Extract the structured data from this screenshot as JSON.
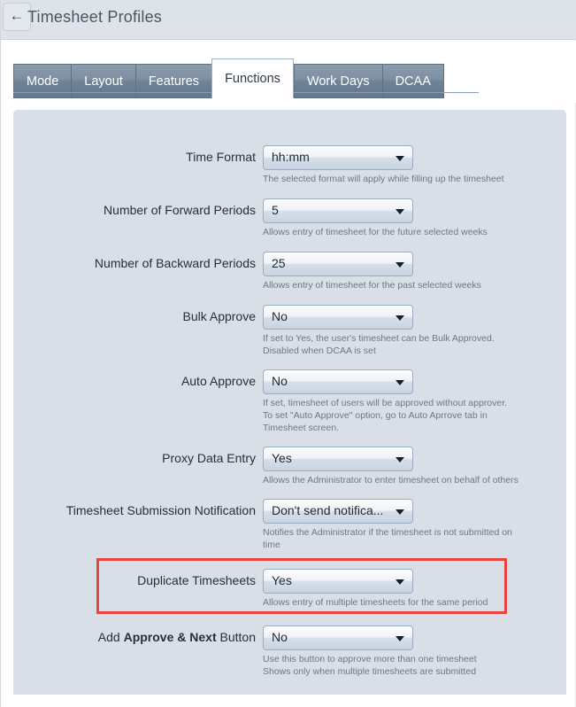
{
  "header": {
    "back_icon": "back-arrow-icon",
    "title": "Timesheet Profiles"
  },
  "tabs": [
    {
      "label": "Mode",
      "active": false
    },
    {
      "label": "Layout",
      "active": false
    },
    {
      "label": "Features",
      "active": false
    },
    {
      "label": "Functions",
      "active": true
    },
    {
      "label": "Work Days",
      "active": false
    },
    {
      "label": "DCAA",
      "active": false
    }
  ],
  "form": {
    "rows": [
      {
        "label": "Time Format",
        "value": "hh:mm",
        "help": "The selected format will apply while filling up the timesheet"
      },
      {
        "label": "Number of Forward Periods",
        "value": "5",
        "help": "Allows entry of timesheet for the future selected weeks"
      },
      {
        "label": "Number of Backward Periods",
        "value": "25",
        "help": "Allows entry of timesheet for the past selected weeks"
      },
      {
        "label": "Bulk Approve",
        "value": "No",
        "help": "If set to Yes, the user's timesheet can be Bulk Approved.\nDisabled when DCAA is set"
      },
      {
        "label": "Auto Approve",
        "value": "No",
        "help": "If set, timesheet of users will be approved without approver.\nTo set \"Auto Approve\" option, go to Auto Aprrove tab in\nTimesheet screen."
      },
      {
        "label": "Proxy Data Entry",
        "value": "Yes",
        "help": "Allows the Administrator to enter timesheet on behalf of others"
      },
      {
        "label": "Timesheet Submission Notification",
        "value": "Don't send notifica...",
        "help": "Notifies the Administrator if the timesheet is not submitted on\ntime"
      },
      {
        "label": "Duplicate Timesheets",
        "value": "Yes",
        "help": "Allows entry of multiple timesheets for the same period"
      },
      {
        "label_prefix": "Add ",
        "label_bold": "Approve & Next",
        "label_suffix": " Button",
        "value": "No",
        "help": "Use this button to approve more than one timesheet\nShows only when multiple timesheets are submitted"
      }
    ]
  },
  "highlight": {
    "color": "#e8453c",
    "target_row_label": "Duplicate Timesheets"
  },
  "colors": {
    "header_bg": "#dee3e9",
    "panel_bg": "#d9dfe7",
    "tab_inactive": "#6e8298",
    "tab_active": "#ffffff",
    "highlight_red": "#e8453c"
  }
}
